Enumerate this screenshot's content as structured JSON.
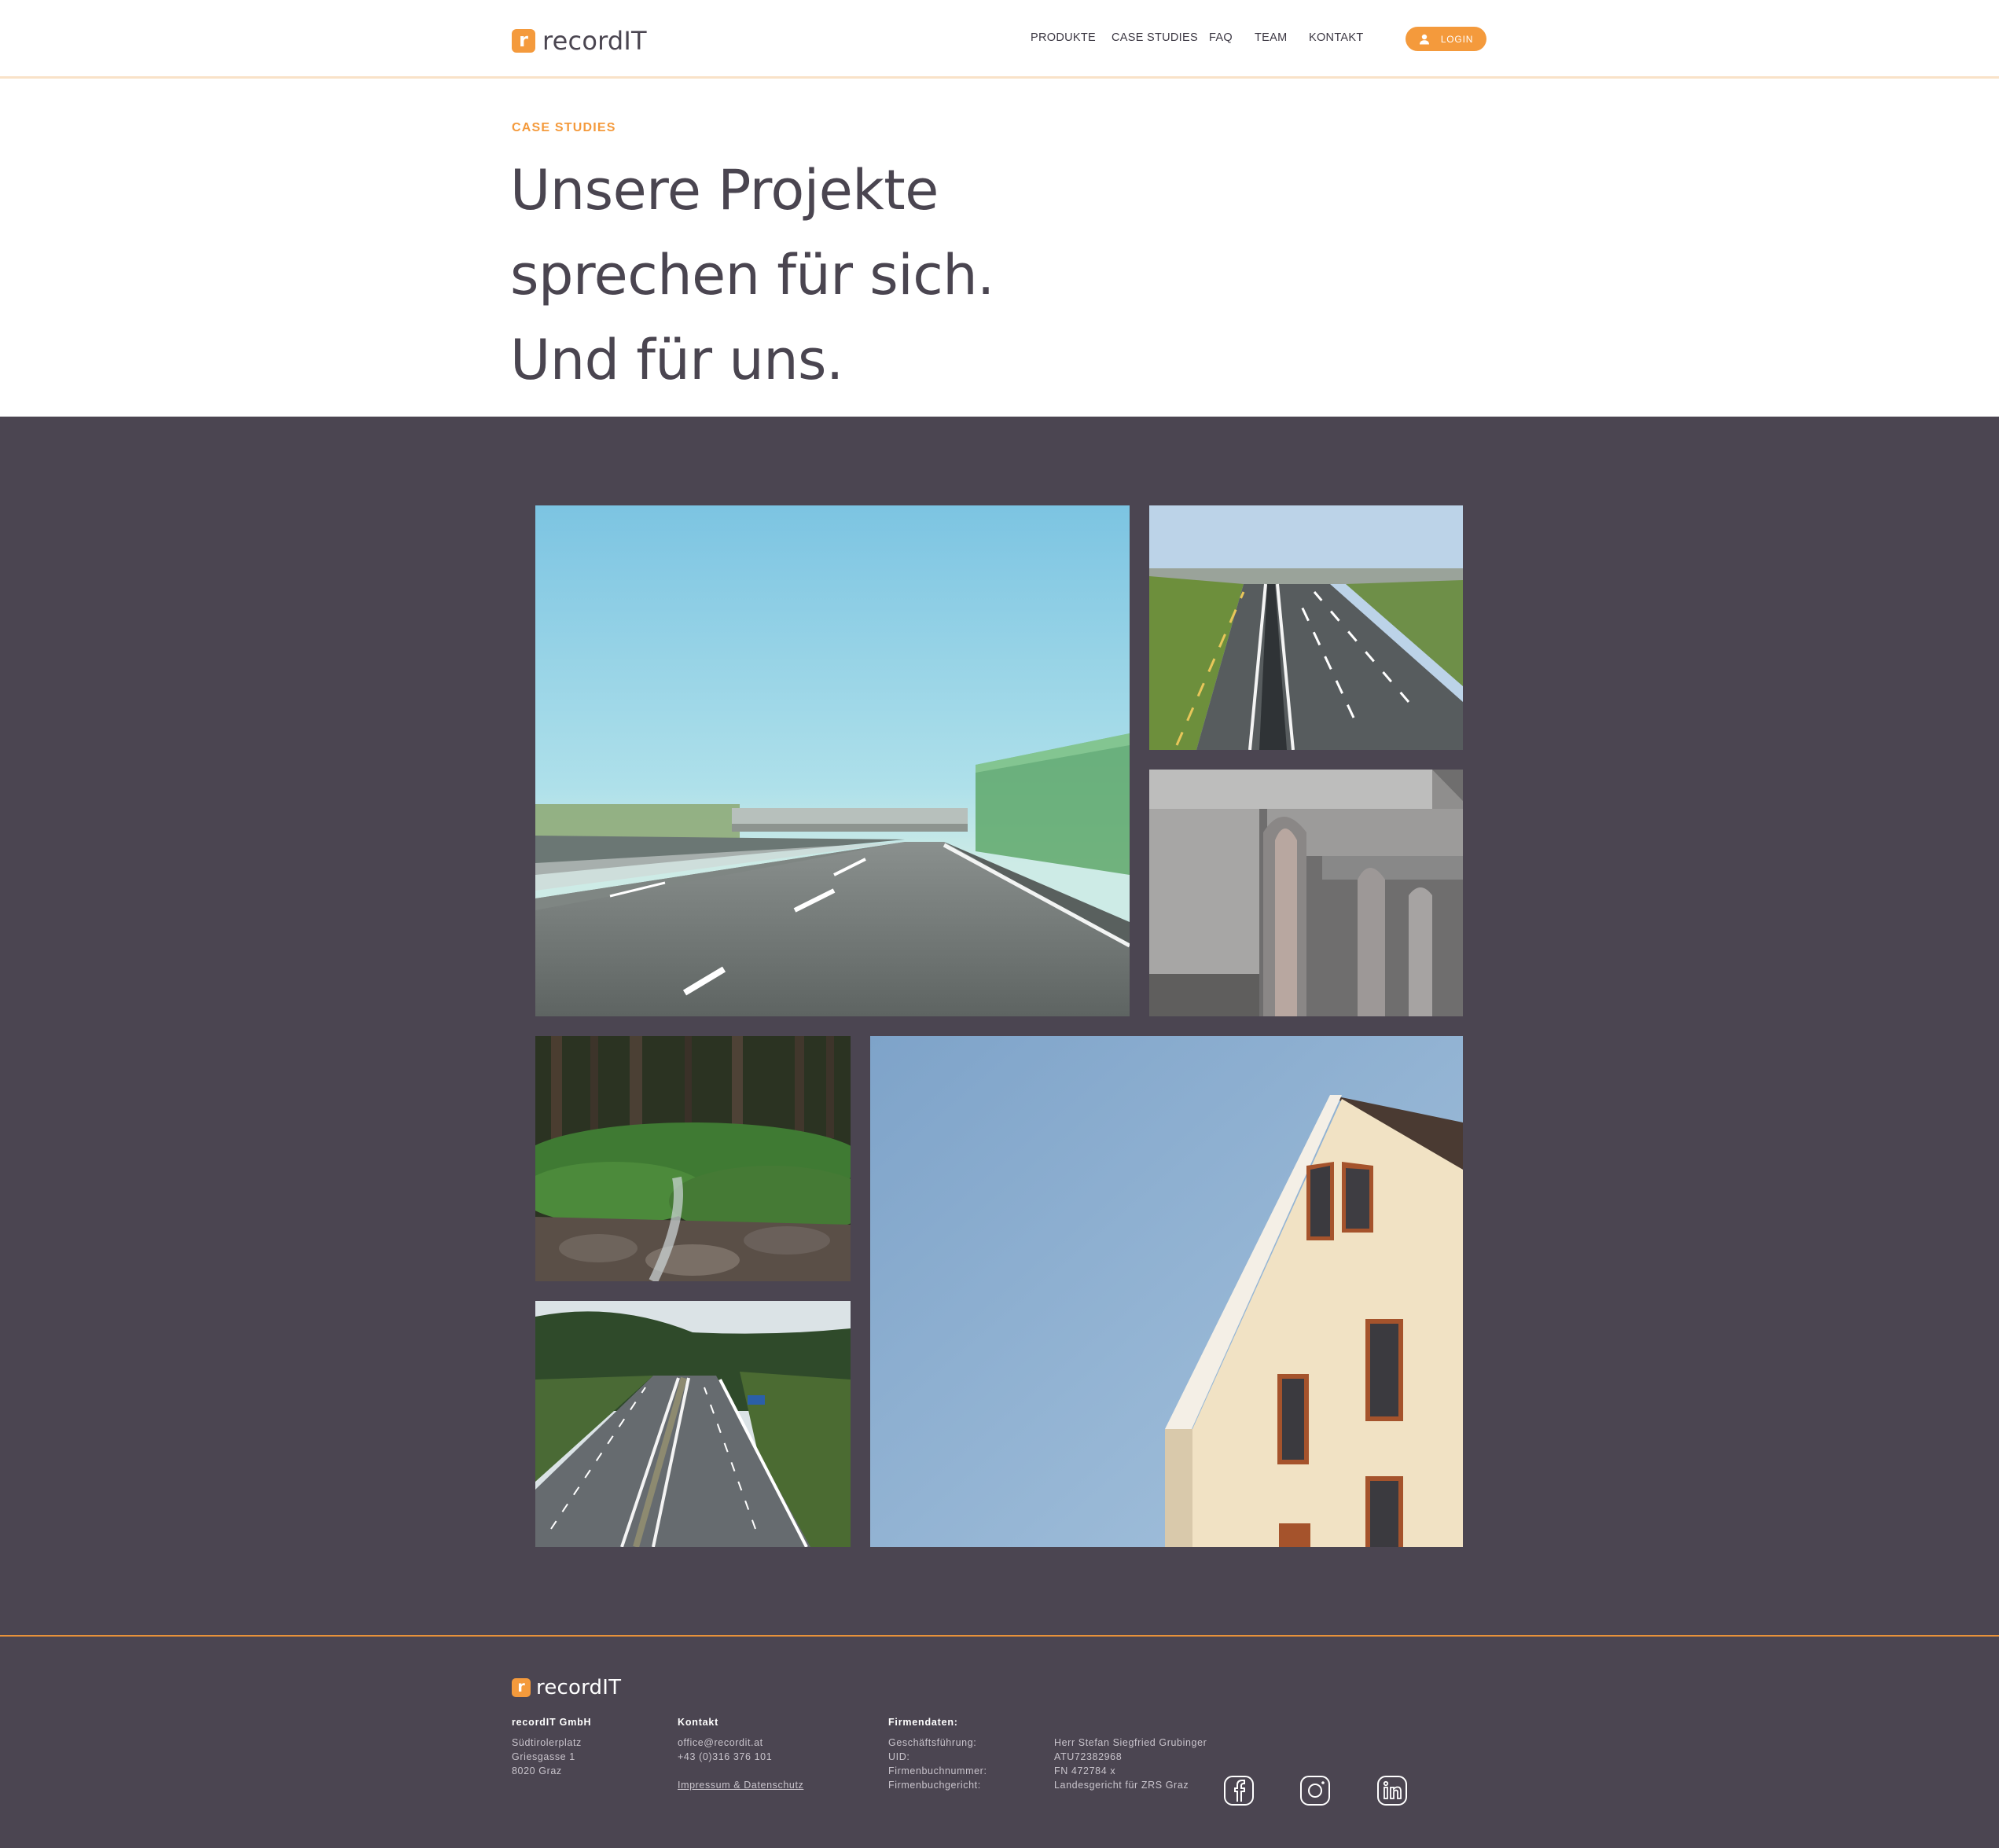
{
  "header": {
    "logo_letter": "r",
    "logo_text": "recordIT",
    "nav": [
      {
        "label": "PRODUKTE"
      },
      {
        "label": "CASE STUDIES"
      },
      {
        "label": "FAQ"
      },
      {
        "label": "TEAM"
      },
      {
        "label": "KONTAKT"
      }
    ],
    "login_label": "LOGIN"
  },
  "hero": {
    "eyebrow": "CASE STUDIES",
    "headline_lines": [
      "Unsere Projekte",
      "sprechen für sich.",
      "Und für uns."
    ]
  },
  "gallery": {
    "images": [
      {
        "subject": "blurred motorway with noise barrier and overpass"
      },
      {
        "subject": "curving motorway aerial view"
      },
      {
        "subject": "weathered concrete bridge pillars"
      },
      {
        "subject": "forest stream with rocks"
      },
      {
        "subject": "house gable against blue sky"
      },
      {
        "subject": "motorway through wooded hills"
      }
    ]
  },
  "footer": {
    "logo_letter": "r",
    "logo_text": "recordIT",
    "company": {
      "name": "recordIT GmbH",
      "lines": [
        "Südtirolerplatz",
        "Griesgasse 1",
        "8020 Graz"
      ]
    },
    "contact": {
      "heading": "Kontakt",
      "email": "office@recordit.at",
      "phone": "+43 (0)316 376 101",
      "legal_link": "Impressum & Datenschutz"
    },
    "firmendaten": {
      "heading": "Firmendaten:",
      "labels": [
        "Geschäftsführung:",
        "UID:",
        "Firmenbuchnummer:",
        "Firmenbuchgericht:"
      ],
      "values": [
        "Herr Stefan Siegfried Grubinger",
        "ATU72382968",
        "FN 472784 x",
        "Landesgericht für ZRS Graz"
      ]
    },
    "social": [
      "facebook-icon",
      "instagram-icon",
      "linkedin-icon"
    ]
  },
  "colors": {
    "accent": "#f49a3c",
    "dark_band": "#4b4551",
    "text": "#4a4550"
  }
}
